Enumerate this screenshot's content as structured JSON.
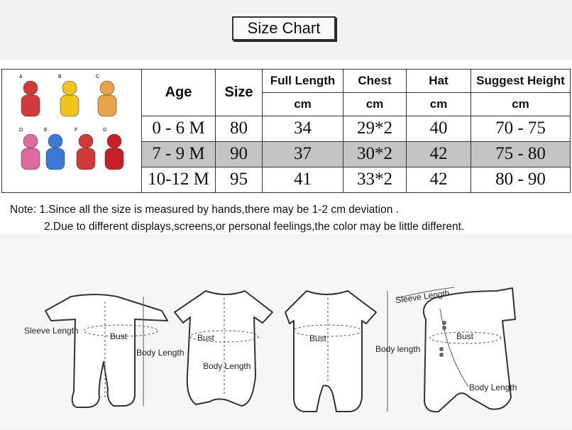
{
  "title": "Size Chart",
  "product_thumbs": [
    {
      "letter": "A",
      "color": "#d23a3a"
    },
    {
      "letter": "B",
      "color": "#f0c419"
    },
    {
      "letter": "C",
      "color": "#e8a24a"
    },
    {
      "letter": "D",
      "color": "#e06aa0"
    },
    {
      "letter": "E",
      "color": "#3a7ad6"
    },
    {
      "letter": "F",
      "color": "#d23a3a"
    },
    {
      "letter": "G",
      "color": "#c8202a"
    }
  ],
  "table": {
    "headers": {
      "age": "Age",
      "size": "Size",
      "full_length": "Full Length",
      "chest": "Chest",
      "hat": "Hat",
      "suggest_height": "Suggest Height",
      "unit": "cm"
    },
    "rows": [
      {
        "age": "0 - 6 M",
        "size": "80",
        "full_length": "34",
        "chest": "29*2",
        "hat": "40",
        "height": "70 - 75"
      },
      {
        "age": "7 - 9 M",
        "size": "90",
        "full_length": "37",
        "chest": "30*2",
        "hat": "42",
        "height": "75 - 80"
      },
      {
        "age": "10-12 M",
        "size": "95",
        "full_length": "41",
        "chest": "33*2",
        "hat": "42",
        "height": "80 - 90"
      }
    ]
  },
  "note": {
    "line1": "Note: 1.Since all the size is measured by hands,there may be 1-2 cm deviation .",
    "line2": "2.Due to different displays,screens,or personal feelings,the color may be little different."
  },
  "diagram_labels": {
    "sleeve_length_1": "Sleeve Length",
    "bust_1": "Bust",
    "body_length_1": "Body Length",
    "bust_2": "Bust",
    "body_length_2": "Body Length",
    "bust_3": "Bust",
    "body_length_3": "Body length",
    "sleeve_length_4": "Sleeve Length",
    "bust_4": "Bust",
    "body_length_4": "Body Length"
  }
}
